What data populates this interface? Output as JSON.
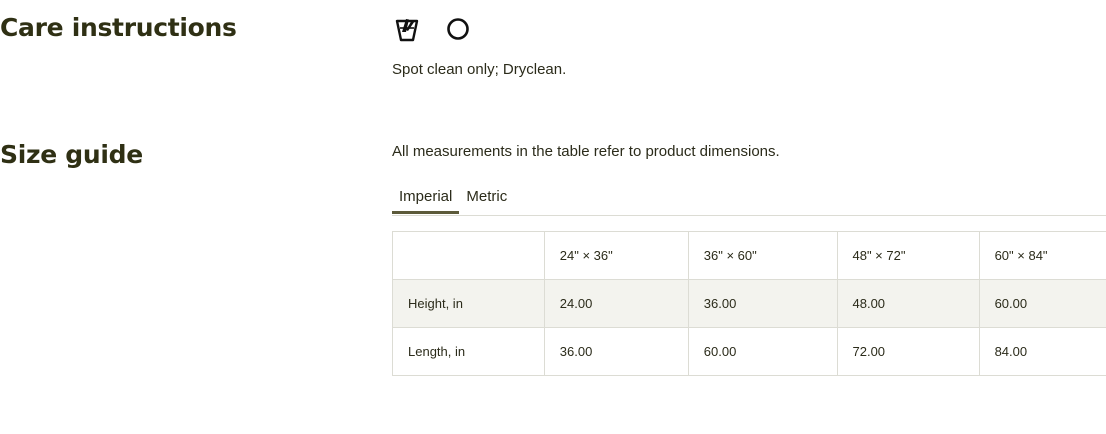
{
  "care": {
    "heading": "Care instructions",
    "icons": [
      "spot-clean-icon",
      "dryclean-circle-icon"
    ],
    "text": "Spot clean only; Dryclean."
  },
  "size_guide": {
    "heading": "Size guide",
    "note": "All measurements in the table refer to product dimensions.",
    "tabs": [
      {
        "label": "Imperial",
        "active": true
      },
      {
        "label": "Metric",
        "active": false
      }
    ],
    "table": {
      "headers": [
        "",
        "24\" × 36\"",
        "36\" × 60\"",
        "48\" × 72\"",
        "60\" × 84\""
      ],
      "rows": [
        {
          "label": "Height, in",
          "values": [
            "24.00",
            "36.00",
            "48.00",
            "60.00"
          ]
        },
        {
          "label": "Length, in",
          "values": [
            "36.00",
            "60.00",
            "72.00",
            "84.00"
          ]
        }
      ]
    }
  },
  "colors": {
    "heading": "#2f3014",
    "text": "#2b2b1a",
    "active_tab_underline": "#5c5a3a",
    "table_border": "#dcdcd4",
    "row_shade": "#f3f3ee"
  }
}
